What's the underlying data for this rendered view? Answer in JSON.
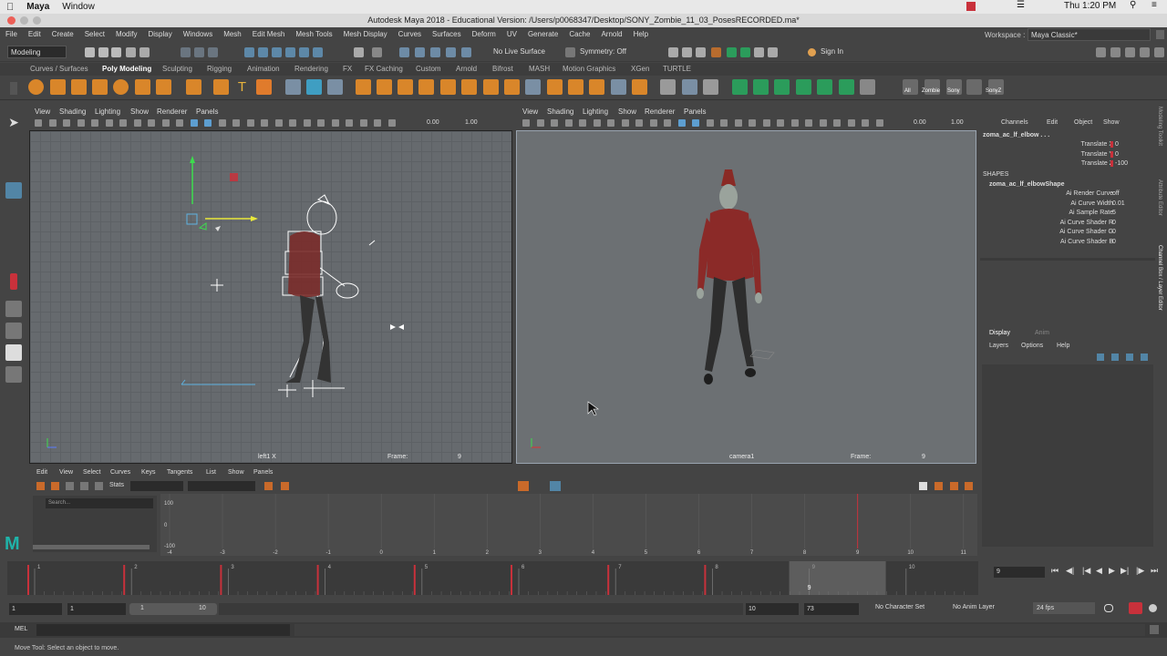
{
  "mac_menu": {
    "app": "Maya",
    "window": "Window",
    "clock": "Thu 1:20 PM"
  },
  "window_title": "Autodesk Maya 2018 - Educational Version: /Users/p0068347/Desktop/SONY_Zombie_11_03_PosesRECORDED.ma*",
  "menubar": [
    "File",
    "Edit",
    "Create",
    "Select",
    "Modify",
    "Display",
    "Windows",
    "Mesh",
    "Edit Mesh",
    "Mesh Tools",
    "Mesh Display",
    "Curves",
    "Surfaces",
    "Deform",
    "UV",
    "Generate",
    "Cache",
    "Arnold",
    "Help"
  ],
  "workspace": {
    "label": "Workspace :",
    "value": "Maya Classic*"
  },
  "statusline": {
    "mode": "Modeling",
    "live_surface": "No Live Surface",
    "symmetry": "Symmetry: Off",
    "sign_in": "Sign In"
  },
  "shelf_tabs": [
    "Curves / Surfaces",
    "Poly Modeling",
    "Sculpting",
    "Rigging",
    "Animation",
    "Rendering",
    "FX",
    "FX Caching",
    "Custom",
    "Arnold",
    "Bifrost",
    "MASH",
    "Motion Graphics",
    "XGen",
    "TURTLE"
  ],
  "shelf_active_tab": "Poly Modeling",
  "shelf_labels": [
    "All",
    "Zombie",
    "Sony",
    "SonyZ"
  ],
  "left_panel": {
    "menus": [
      "View",
      "Shading",
      "Lighting",
      "Show",
      "Renderer",
      "Panels"
    ],
    "val_a": "0.00",
    "val_b": "1.00",
    "camera": "left1 X",
    "frame_label": "Frame:",
    "frame_value": "9"
  },
  "right_panel": {
    "menus": [
      "View",
      "Shading",
      "Lighting",
      "Show",
      "Renderer",
      "Panels"
    ],
    "val_a": "0.00",
    "val_b": "1.00",
    "camera": "camera1",
    "frame_label": "Frame:",
    "frame_value": "9"
  },
  "channel_box": {
    "menus": [
      "Channels",
      "Edit",
      "Object",
      "Show"
    ],
    "object": "zoma_ac_lf_elbow . . .",
    "attrs": [
      {
        "name": "Translate X",
        "value": "0"
      },
      {
        "name": "Translate Y",
        "value": "0"
      },
      {
        "name": "Translate Z",
        "value": "-100"
      }
    ],
    "shapes_header": "SHAPES",
    "shape_name": "zoma_ac_lf_elbowShape",
    "shape_attrs": [
      {
        "name": "Ai Render Curve",
        "value": "off"
      },
      {
        "name": "Ai Curve Width",
        "value": "0.01"
      },
      {
        "name": "Ai Sample Rate",
        "value": "5"
      },
      {
        "name": "Ai Curve Shader R",
        "value": "0"
      },
      {
        "name": "Ai Curve Shader G",
        "value": "0"
      },
      {
        "name": "Ai Curve Shader B",
        "value": "0"
      }
    ],
    "layer_tabs": [
      "Display",
      "Anim"
    ],
    "layer_menus": [
      "Layers",
      "Options",
      "Help"
    ],
    "side_tabs": [
      "Modeling Toolkit",
      "Attribute Editor",
      "Channel Box / Layer Editor"
    ]
  },
  "graph_editor": {
    "menus": [
      "Edit",
      "View",
      "Select",
      "Curves",
      "Keys",
      "Tangents",
      "List",
      "Show",
      "Panels"
    ],
    "stats": "Stats",
    "search_placeholder": "Search...",
    "y_labels": [
      "100",
      "0",
      "-100"
    ],
    "x_labels": [
      "-4",
      "-3",
      "-2",
      "-1",
      "0",
      "1",
      "2",
      "3",
      "4",
      "5",
      "6",
      "7",
      "8",
      "9",
      "10",
      "11"
    ]
  },
  "timeline": {
    "ticks": [
      "1",
      "2",
      "3",
      "4",
      "5",
      "6",
      "7",
      "8",
      "9",
      "10"
    ],
    "current_frame": "9",
    "current_frame_field": "9"
  },
  "range": {
    "start": "1",
    "start2": "1",
    "slider_a": "1",
    "slider_b": "10",
    "end": "10",
    "end2": "73",
    "char_set": "No Character Set",
    "anim_layer": "No Anim Layer",
    "fps": "24 fps"
  },
  "mel_label": "MEL",
  "help_line": "Move Tool: Select an object to move.",
  "colors": {
    "accent_blue": "#5285a6",
    "keyframe_red": "#c8313b",
    "maya_teal": "#1fb3a9"
  }
}
